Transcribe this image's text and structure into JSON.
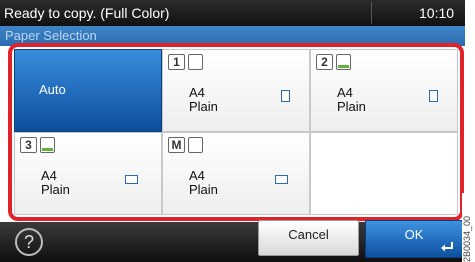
{
  "status": {
    "message": "Ready to copy. (Full Color)",
    "time": "10:10"
  },
  "screen": {
    "title": "Paper Selection"
  },
  "paper_options": {
    "auto": {
      "label": "Auto",
      "selected": true
    },
    "tray1": {
      "badge": "1",
      "size": "A4",
      "type": "Plain",
      "level": "empty",
      "orientation": "portrait"
    },
    "tray2": {
      "badge": "2",
      "size": "A4",
      "type": "Plain",
      "level": "low",
      "orientation": "portrait"
    },
    "tray3": {
      "badge": "3",
      "size": "A4",
      "type": "Plain",
      "level": "low",
      "orientation": "landscape"
    },
    "manual": {
      "badge": "M",
      "size": "A4",
      "type": "Plain",
      "level": "empty",
      "orientation": "landscape"
    }
  },
  "buttons": {
    "cancel": "Cancel",
    "ok": "OK",
    "help_glyph": "?"
  },
  "image_code": "2B0034_00",
  "colors": {
    "highlight": "#e0222b",
    "selected": "#1b63b8",
    "tray_level": "#62b33c"
  }
}
